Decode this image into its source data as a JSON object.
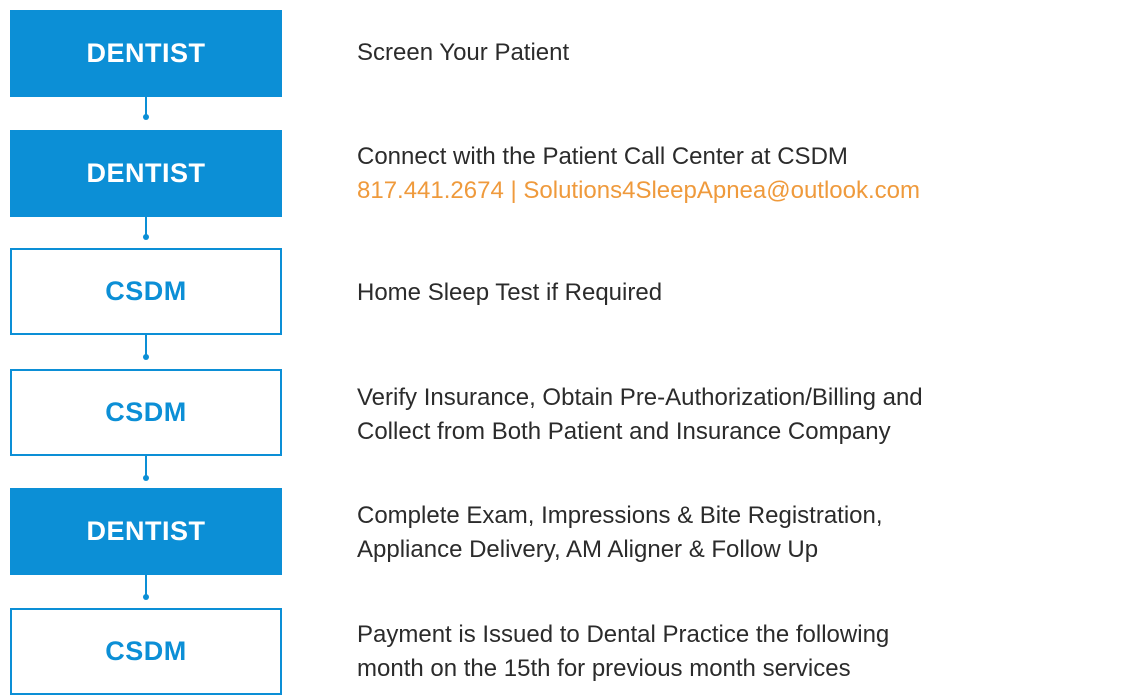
{
  "colors": {
    "accent_blue": "#0c8fd6",
    "contact_orange": "#ef9a3c",
    "text_dark": "#2b2b2b"
  },
  "steps": [
    {
      "role": "DENTIST",
      "style": "filled",
      "lines": [
        "Screen Your Patient"
      ]
    },
    {
      "role": "DENTIST",
      "style": "filled",
      "lines": [
        "Connect with the Patient Call Center at CSDM"
      ],
      "contact": "817.441.2674 | Solutions4SleepApnea@outlook.com"
    },
    {
      "role": "CSDM",
      "style": "outline",
      "lines": [
        "Home Sleep Test if Required"
      ]
    },
    {
      "role": "CSDM",
      "style": "outline",
      "lines": [
        "Verify Insurance, Obtain Pre-Authorization/Billing and",
        "Collect from Both Patient and Insurance Company"
      ]
    },
    {
      "role": "DENTIST",
      "style": "filled",
      "lines": [
        "Complete Exam, Impressions & Bite Registration,",
        "Appliance Delivery, AM Aligner & Follow Up"
      ]
    },
    {
      "role": "CSDM",
      "style": "outline",
      "lines": [
        "Payment is Issued to Dental Practice the following",
        "month on the 15th for previous month services"
      ]
    }
  ]
}
